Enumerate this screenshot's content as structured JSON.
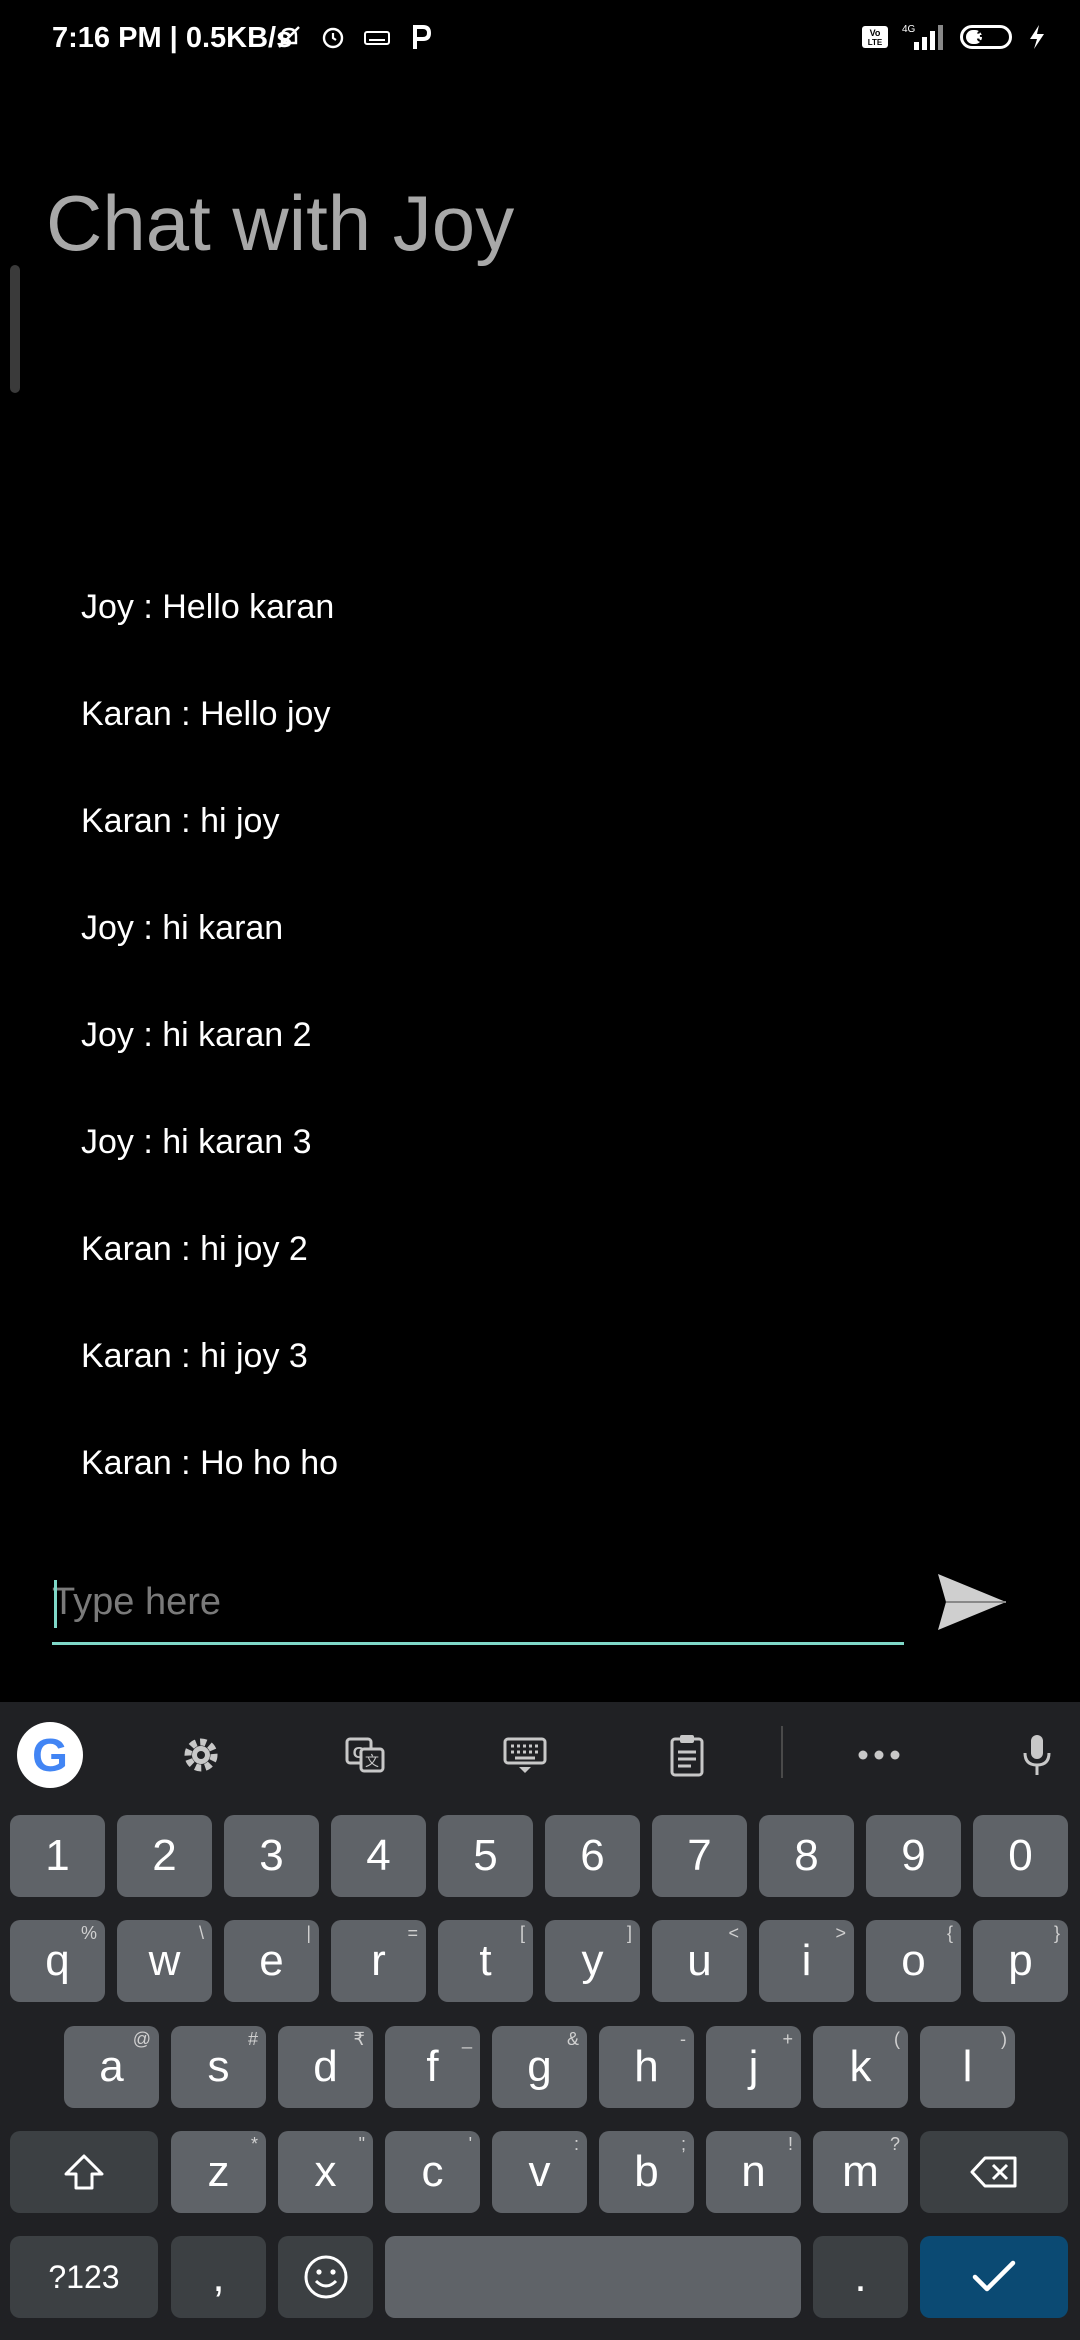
{
  "status_bar": {
    "time": "7:16 PM | 0.5KB/s",
    "battery": "39"
  },
  "chat": {
    "title": "Chat with Joy",
    "messages": [
      "Joy : Hello karan",
      "Karan : Hello joy",
      "Karan : hi joy",
      "Joy : hi karan",
      "Joy : hi karan 2",
      "Joy : hi karan 3",
      "Karan : hi joy 2",
      "Karan : hi joy 3",
      "Karan : Ho ho ho"
    ]
  },
  "input": {
    "placeholder": "Type here",
    "value": ""
  },
  "icons": {
    "send": "send-icon",
    "google": "google-icon",
    "settings": "gear-icon",
    "translate": "translate-icon",
    "keyboard": "keyboard-icon",
    "clipboard": "clipboard-icon",
    "more": "more-icon",
    "mic": "mic-icon"
  },
  "keyboard": {
    "google_letter": "G",
    "number_row": [
      "1",
      "2",
      "3",
      "4",
      "5",
      "6",
      "7",
      "8",
      "9",
      "0"
    ],
    "row1": [
      {
        "k": "q",
        "h": "%"
      },
      {
        "k": "w",
        "h": "\\"
      },
      {
        "k": "e",
        "h": "|"
      },
      {
        "k": "r",
        "h": "="
      },
      {
        "k": "t",
        "h": "["
      },
      {
        "k": "y",
        "h": "]"
      },
      {
        "k": "u",
        "h": "<"
      },
      {
        "k": "i",
        "h": ">"
      },
      {
        "k": "o",
        "h": "{"
      },
      {
        "k": "p",
        "h": "}"
      }
    ],
    "row2": [
      {
        "k": "a",
        "h": "@"
      },
      {
        "k": "s",
        "h": "#"
      },
      {
        "k": "d",
        "h": "₹"
      },
      {
        "k": "f",
        "h": "_"
      },
      {
        "k": "g",
        "h": "&"
      },
      {
        "k": "h",
        "h": "-"
      },
      {
        "k": "j",
        "h": "+"
      },
      {
        "k": "k",
        "h": "("
      },
      {
        "k": "l",
        "h": ")"
      }
    ],
    "row3": [
      {
        "k": "z",
        "h": "*"
      },
      {
        "k": "x",
        "h": "\""
      },
      {
        "k": "c",
        "h": "'"
      },
      {
        "k": "v",
        "h": ":"
      },
      {
        "k": "b",
        "h": ";"
      },
      {
        "k": "n",
        "h": "!"
      },
      {
        "k": "m",
        "h": "?"
      }
    ],
    "symbols_label": "?123",
    "comma": ",",
    "period": "."
  },
  "colors": {
    "accent": "#7fd8c8",
    "key": "#5f6368",
    "key_dark": "#3c4043",
    "enter": "#0b4a73",
    "keyboard_bg": "#202124"
  }
}
